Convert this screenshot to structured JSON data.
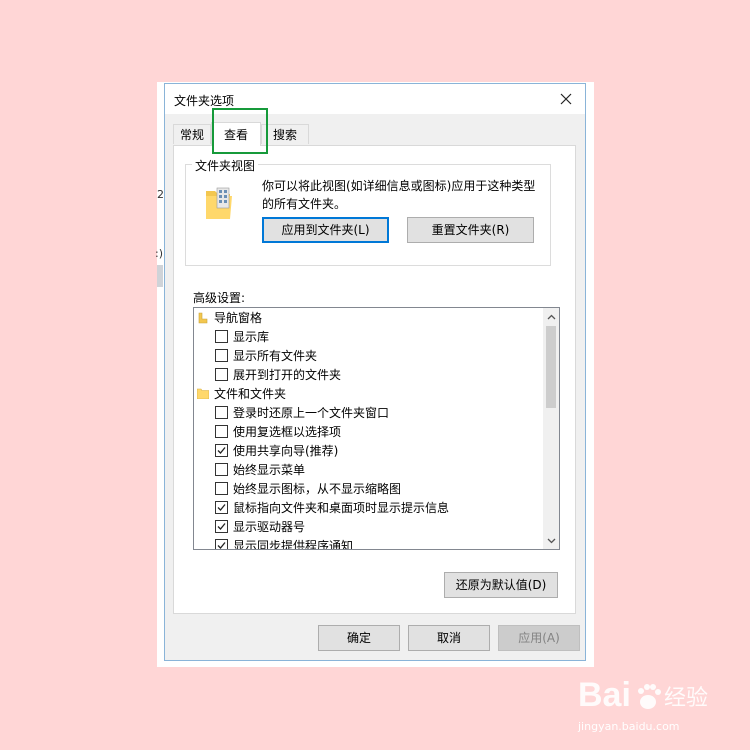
{
  "dialog": {
    "title": "文件夹选项",
    "tabs": [
      {
        "label": "常规"
      },
      {
        "label": "查看"
      },
      {
        "label": "搜索"
      }
    ],
    "active_tab": "查看"
  },
  "folder_views": {
    "legend": "文件夹视图",
    "description": "你可以将此视图(如详细信息或图标)应用于这种类型的所有文件夹。",
    "apply_button": "应用到文件夹(L)",
    "reset_button": "重置文件夹(R)"
  },
  "advanced": {
    "label": "高级设置:",
    "items": [
      {
        "type": "group",
        "icon": "navigation-pane-icon",
        "label": "导航窗格"
      },
      {
        "type": "checkbox",
        "checked": false,
        "label": "显示库"
      },
      {
        "type": "checkbox",
        "checked": false,
        "label": "显示所有文件夹"
      },
      {
        "type": "checkbox",
        "checked": false,
        "label": "展开到打开的文件夹"
      },
      {
        "type": "group",
        "icon": "folder-icon",
        "label": "文件和文件夹"
      },
      {
        "type": "checkbox",
        "checked": false,
        "label": "登录时还原上一个文件夹窗口"
      },
      {
        "type": "checkbox",
        "checked": false,
        "label": "使用复选框以选择项"
      },
      {
        "type": "checkbox",
        "checked": true,
        "label": "使用共享向导(推荐)"
      },
      {
        "type": "checkbox",
        "checked": false,
        "label": "始终显示菜单"
      },
      {
        "type": "checkbox",
        "checked": false,
        "label": "始终显示图标，从不显示缩略图"
      },
      {
        "type": "checkbox",
        "checked": true,
        "label": "鼠标指向文件夹和桌面项时显示提示信息"
      },
      {
        "type": "checkbox",
        "checked": true,
        "label": "显示驱动器号"
      },
      {
        "type": "checkbox",
        "checked": true,
        "label": "显示同步提供程序通知"
      }
    ],
    "restore_button": "还原为默认值(D)"
  },
  "footer": {
    "ok": "确定",
    "cancel": "取消",
    "apply": "应用(A)"
  },
  "background_fragments": [
    "2.",
    ":)"
  ],
  "watermark": {
    "brand": "Bai 经验",
    "url": "jingyan.baidu.com"
  }
}
